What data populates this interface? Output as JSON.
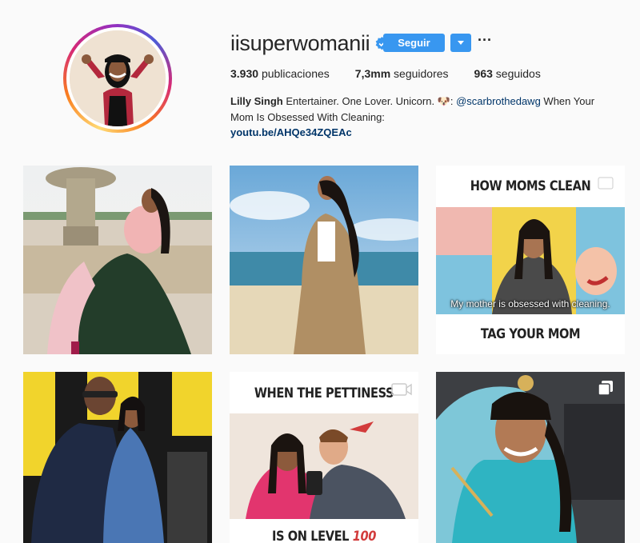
{
  "profile": {
    "username": "iisuperwomanii",
    "follow_label": "Seguir",
    "more_label": "···",
    "stats": {
      "posts_value": "3.930",
      "posts_label": "publicaciones",
      "followers_value": "7,3mm",
      "followers_label": "seguidores",
      "following_value": "963",
      "following_label": "seguidos"
    },
    "bio": {
      "name": "Lilly Singh",
      "text1": "Entertainer. One Lover. Unicorn. 🐶: ",
      "mention": "@scarbrothedawg",
      "text2": " When Your Mom Is Obsessed With Cleaning:",
      "link": "youtu.be/AHQe34ZQEAc"
    }
  },
  "posts": [
    {
      "type": "photo"
    },
    {
      "type": "photo"
    },
    {
      "type": "video",
      "top_caption": "HOW MOMS CLEAN",
      "subtitle": "My mother is obsessed with cleaning.",
      "bottom_caption": "TAG YOUR MOM"
    },
    {
      "type": "photo"
    },
    {
      "type": "video",
      "top_caption": "WHEN THE PETTINESS",
      "bottom_caption": "IS ON LEVEL",
      "bottom_number": "100"
    },
    {
      "type": "carousel"
    }
  ],
  "colors": {
    "accent": "#3897f0",
    "link": "#003569",
    "background": "#fafafa"
  }
}
